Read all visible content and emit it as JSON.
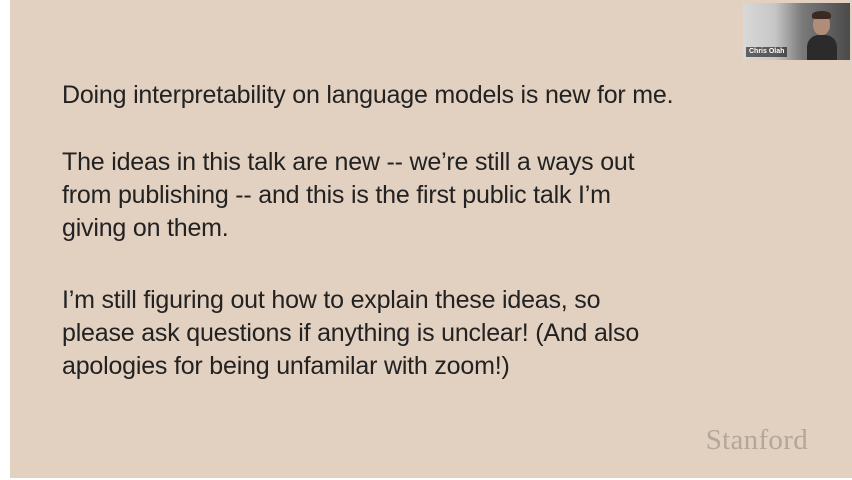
{
  "slide": {
    "paragraphs": [
      {
        "lines": [
          "Doing interpretability on language models is new for me."
        ]
      },
      {
        "lines": [
          "The ideas in this talk are new -- we’re still a ways out",
          "from publishing -- and this is the first public talk I’m",
          "giving on them."
        ]
      },
      {
        "lines": [
          "I’m still figuring out how to explain these ideas, so",
          "please ask questions if anything is unclear! (And also",
          "apologies for being unfamilar with zoom!)"
        ]
      }
    ],
    "brand": "Stanford",
    "background_color": "#e2d0c0",
    "text_color": "#222222",
    "brand_color": "#b3a69a"
  },
  "video": {
    "participant_name": "Chris Olah"
  }
}
